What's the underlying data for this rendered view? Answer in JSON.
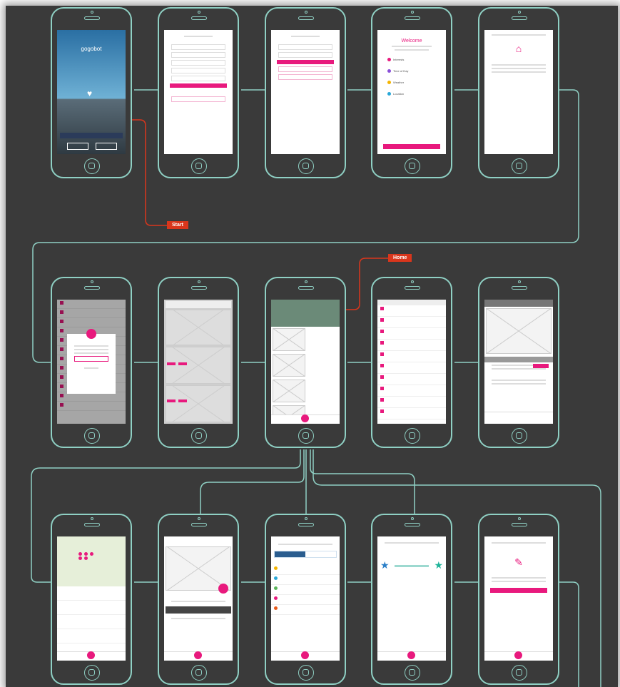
{
  "labels": {
    "start": "Start",
    "home": "Home"
  },
  "colors": {
    "background": "#3a3a3a",
    "outline": "#8fd0c4",
    "accent": "#e8197d",
    "tag": "#d9361c"
  },
  "screens": {
    "splash": {
      "logo": "gogobot"
    },
    "welcome": {
      "title": "Welcome",
      "items": [
        "Interests",
        "Time of Day",
        "Weather",
        "Location"
      ]
    }
  }
}
